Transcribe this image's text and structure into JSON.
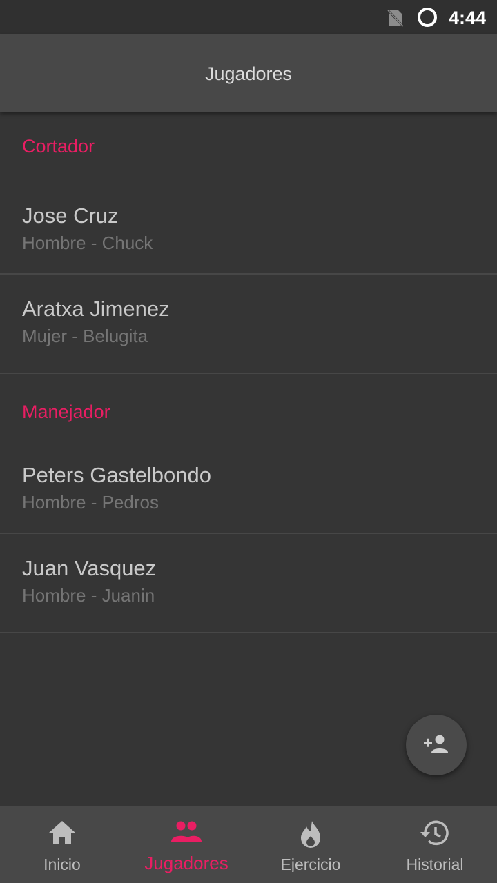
{
  "status_bar": {
    "time": "4:44",
    "sim_icon": "no-sim-icon",
    "battery_icon": "battery-ring-icon"
  },
  "app_bar": {
    "title": "Jugadores"
  },
  "sections": [
    {
      "header": "Cortador",
      "players": [
        {
          "name": "Jose Cruz",
          "detail": "Hombre - Chuck"
        },
        {
          "name": "Aratxa Jimenez",
          "detail": "Mujer - Belugita"
        }
      ]
    },
    {
      "header": "Manejador",
      "players": [
        {
          "name": "Peters Gastelbondo",
          "detail": "Hombre - Pedros"
        },
        {
          "name": "Juan Vasquez",
          "detail": "Hombre - Juanin"
        }
      ]
    }
  ],
  "fab": {
    "icon": "add-person-icon"
  },
  "bottom_nav": {
    "items": [
      {
        "label": "Inicio",
        "icon": "home-icon",
        "active": false
      },
      {
        "label": "Jugadores",
        "icon": "people-icon",
        "active": true
      },
      {
        "label": "Ejercicio",
        "icon": "fire-icon",
        "active": false
      },
      {
        "label": "Historial",
        "icon": "history-icon",
        "active": false
      }
    ]
  },
  "colors": {
    "accent": "#e91e63",
    "background": "#353535",
    "bar": "#484848"
  }
}
